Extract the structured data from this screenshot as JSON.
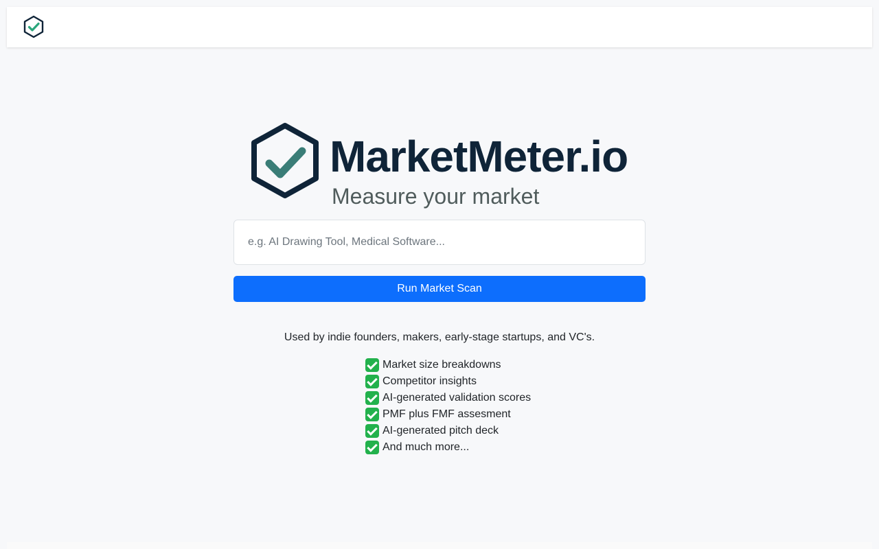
{
  "brand": {
    "name": "MarketMeter.io",
    "tagline": "Measure your market",
    "icon": "hexagon-check-icon",
    "colors": {
      "dark": "#0f2438",
      "check": "#3a7d77",
      "nav_check": "#2aa67c"
    }
  },
  "search": {
    "placeholder": "e.g. AI Drawing Tool, Medical Software...",
    "value": ""
  },
  "scan_button": {
    "label": "Run Market Scan",
    "color": "#0d6efd"
  },
  "used_by": "Used by indie founders, makers, early-stage startups, and VC's.",
  "features": [
    "Market size breakdowns",
    "Competitor insights",
    "AI-generated validation scores",
    "PMF plus FMF assesment",
    "AI-generated pitch deck",
    "And much more..."
  ],
  "feature_icon": "green-check-icon"
}
